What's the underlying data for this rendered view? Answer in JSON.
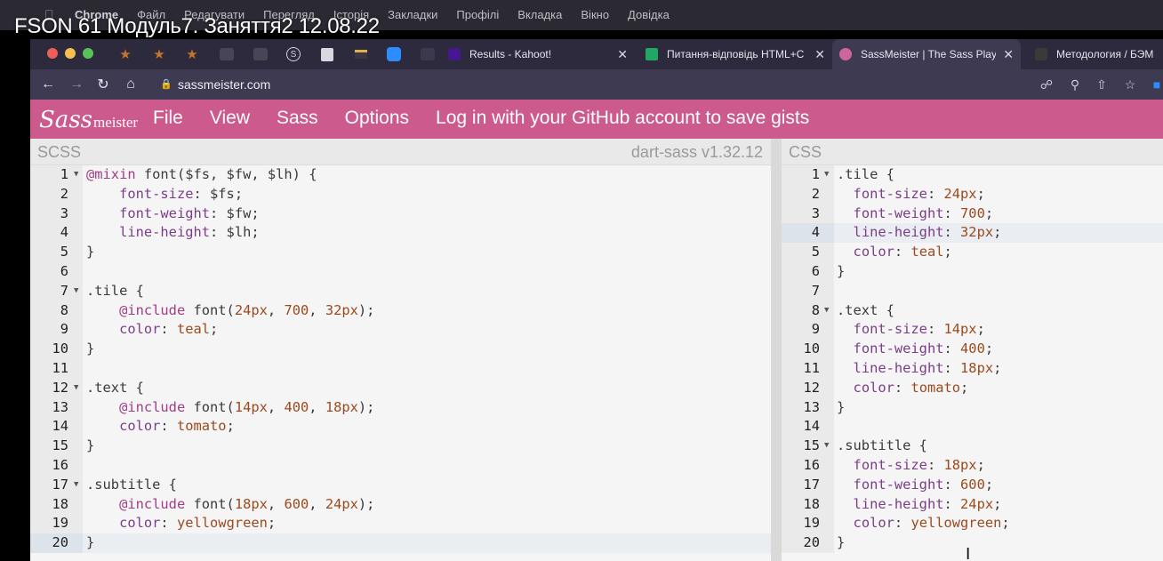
{
  "overlay": {
    "title": "FSON 61 Модуль7. Заняття2 12.08.22"
  },
  "menubar": {
    "app": "Chrome",
    "items": [
      "Файл",
      "Редагувати",
      "Перегляд",
      "Історія",
      "Закладки",
      "Профілі",
      "Вкладка",
      "Вікно",
      "Довідка"
    ]
  },
  "tabs": [
    {
      "label": "Results - Kahoot!",
      "icon": "kahoot-icon"
    },
    {
      "label": "Питання-відповідь HTML+C",
      "icon": "sheets-icon"
    },
    {
      "label": "SassMeister | The Sass Play",
      "icon": "sass-icon",
      "active": true
    },
    {
      "label": "Методология / БЭМ",
      "icon": "github-icon"
    }
  ],
  "address": {
    "url": "sassmeister.com"
  },
  "app": {
    "logo_script": "Sass",
    "logo_rest": "meister",
    "menu": [
      "File",
      "View",
      "Sass",
      "Options",
      "Log in with your GitHub account to save gists"
    ]
  },
  "left_pane": {
    "label": "SCSS",
    "version": "dart-sass v1.32.12"
  },
  "right_pane": {
    "label": "CSS"
  },
  "scss_lines": [
    "@mixin font($fs, $fw, $lh) {",
    "    font-size: $fs;",
    "    font-weight: $fw;",
    "    line-height: $lh;",
    "}",
    "",
    ".tile {",
    "    @include font(24px, 700, 32px);",
    "    color: teal;",
    "}",
    "",
    ".text {",
    "    @include font(14px, 400, 18px);",
    "    color: tomato;",
    "}",
    "",
    ".subtitle {",
    "    @include font(18px, 600, 24px);",
    "    color: yellowgreen;",
    "}"
  ],
  "css_lines": [
    ".tile {",
    "  font-size: 24px;",
    "  font-weight: 700;",
    "  line-height: 32px;",
    "  color: teal;",
    "}",
    "",
    ".text {",
    "  font-size: 14px;",
    "  font-weight: 400;",
    "  line-height: 18px;",
    "  color: tomato;",
    "}",
    "",
    ".subtitle {",
    "  font-size: 18px;",
    "  font-weight: 600;",
    "  line-height: 24px;",
    "  color: yellowgreen;",
    "}"
  ],
  "scss_folds": [
    1,
    7,
    12,
    17
  ],
  "css_folds": [
    1,
    8,
    15
  ],
  "scss_highlight": 20,
  "css_highlight": 4,
  "colors": {
    "sass_pink": "#cd5a8c",
    "tab_bar": "#2d2a3e",
    "address_bar": "#3e3a52"
  }
}
